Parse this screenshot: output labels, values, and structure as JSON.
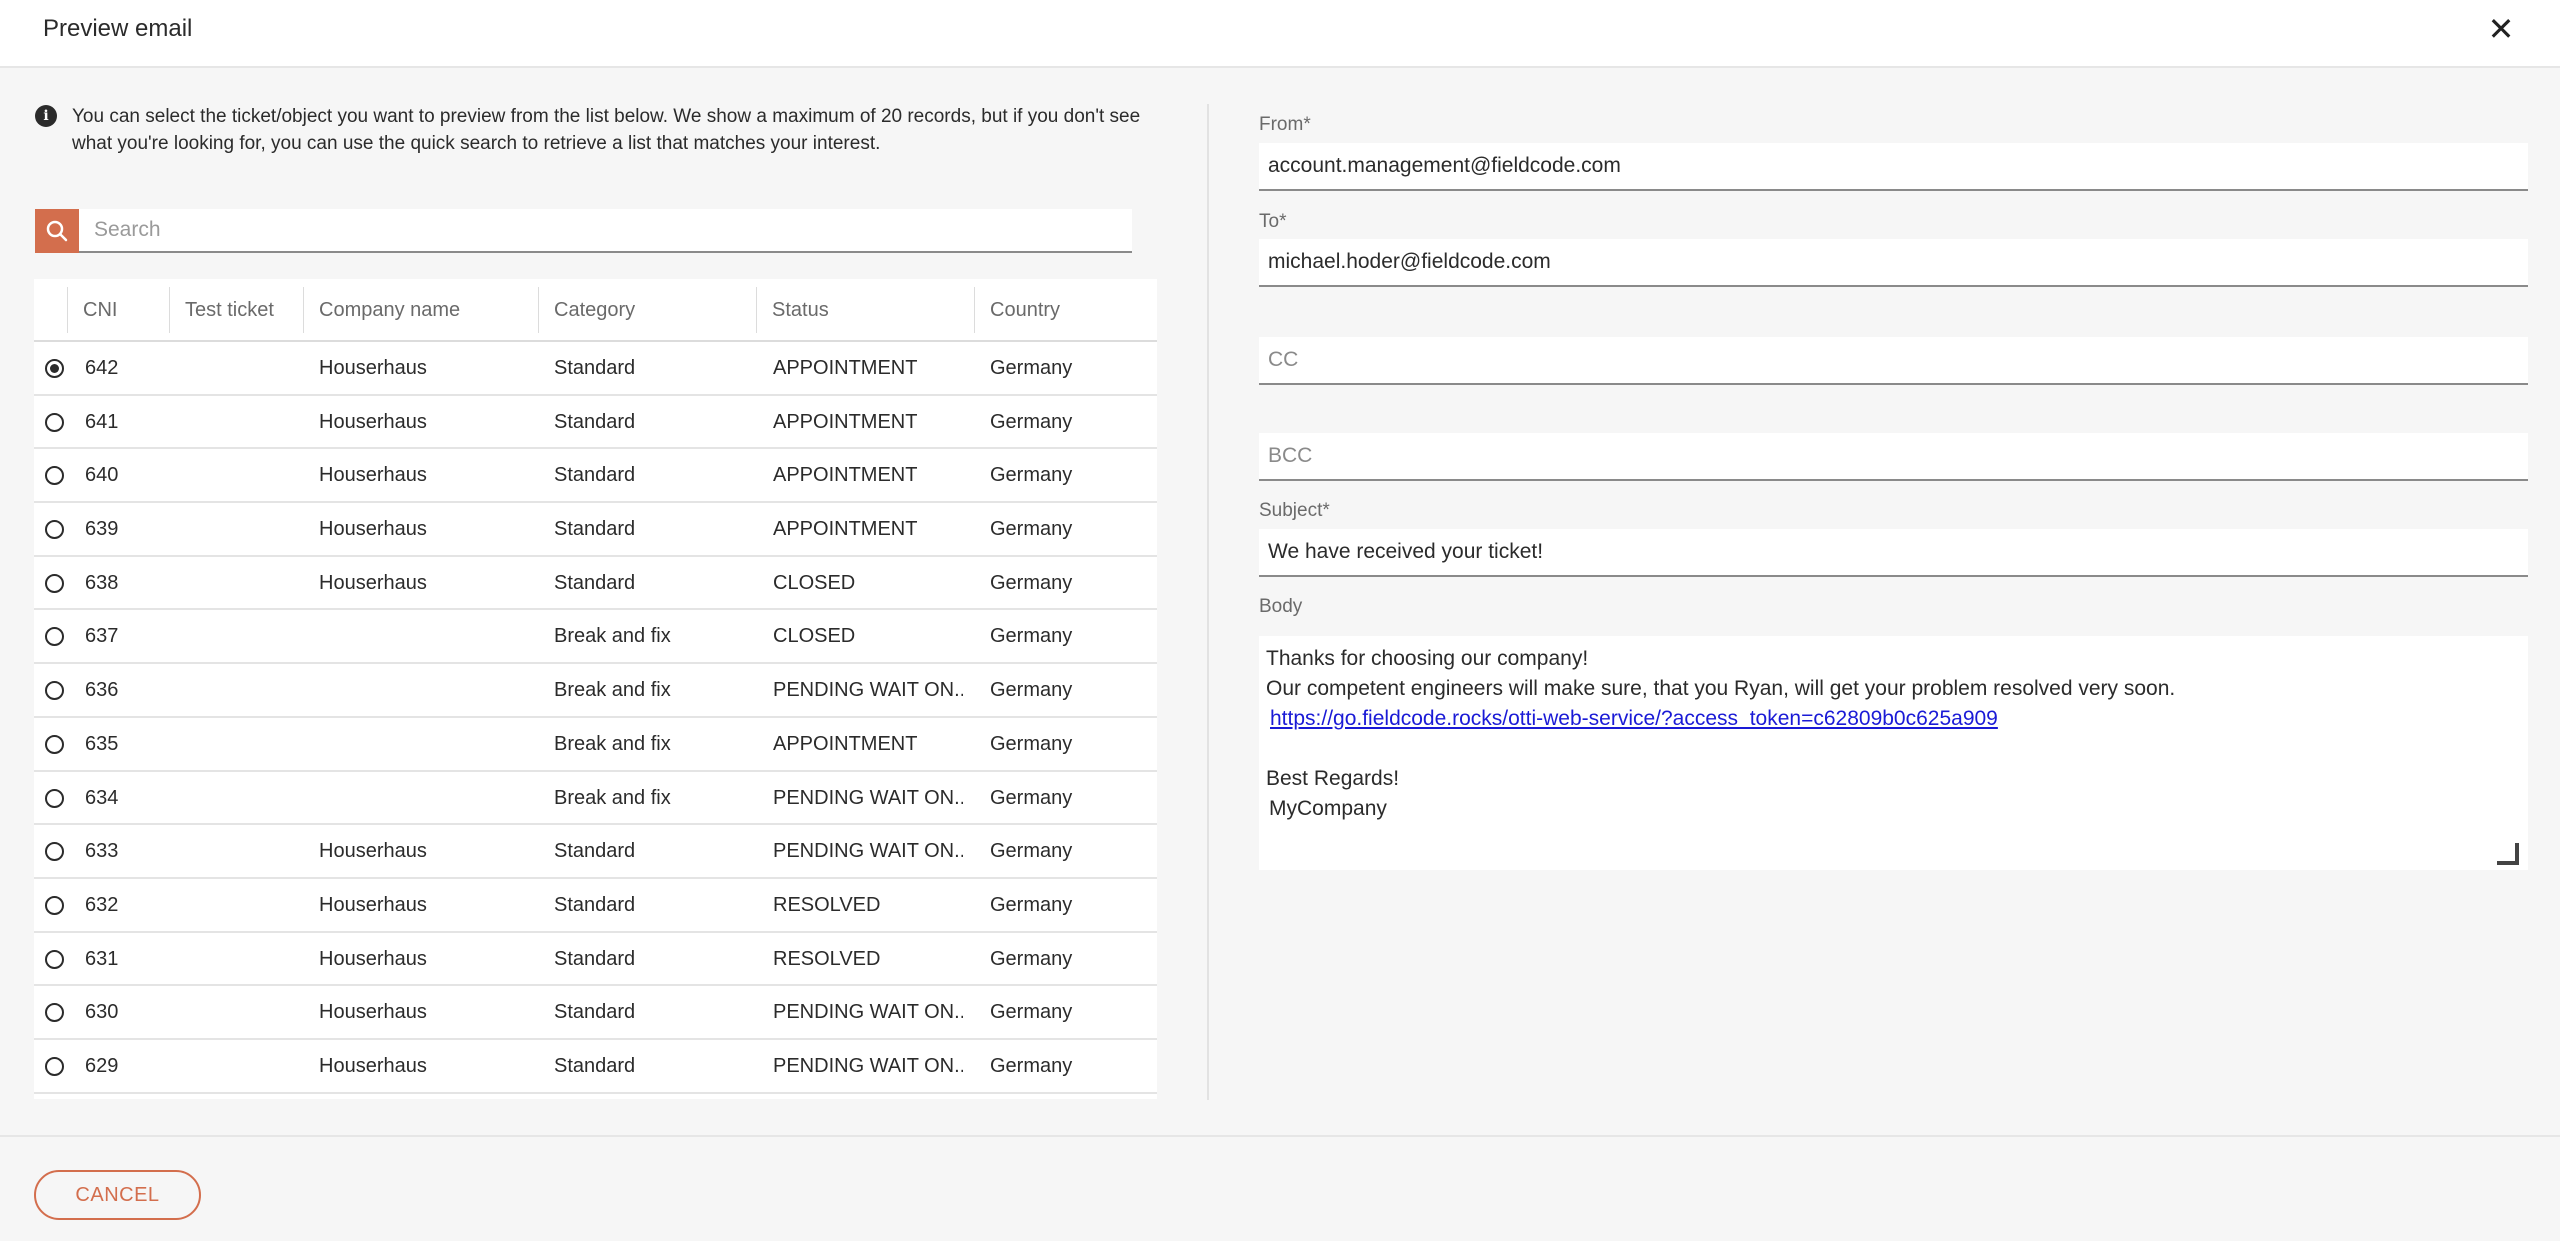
{
  "header": {
    "title": "Preview email",
    "close_icon": "close-icon"
  },
  "info": {
    "icon": "info-icon",
    "text": "You can select the ticket/object you want to preview from the list below. We show a maximum of 20 records, but if you don't see what you're looking for, you can use the quick search to retrieve a list that matches your interest."
  },
  "search": {
    "placeholder": "Search",
    "icon": "search-icon",
    "accent": "#d36e4d"
  },
  "table": {
    "columns": [
      "CNI",
      "Test ticket",
      "Company name",
      "Category",
      "Status",
      "Country"
    ],
    "rows": [
      {
        "selected": true,
        "cni": "642",
        "test": "",
        "company": "Houserhaus",
        "category": "Standard",
        "status": "APPOINTMENT",
        "country": "Germany"
      },
      {
        "selected": false,
        "cni": "641",
        "test": "",
        "company": "Houserhaus",
        "category": "Standard",
        "status": "APPOINTMENT",
        "country": "Germany"
      },
      {
        "selected": false,
        "cni": "640",
        "test": "",
        "company": "Houserhaus",
        "category": "Standard",
        "status": "APPOINTMENT",
        "country": "Germany"
      },
      {
        "selected": false,
        "cni": "639",
        "test": "",
        "company": "Houserhaus",
        "category": "Standard",
        "status": "APPOINTMENT",
        "country": "Germany"
      },
      {
        "selected": false,
        "cni": "638",
        "test": "",
        "company": "Houserhaus",
        "category": "Standard",
        "status": "CLOSED",
        "country": "Germany"
      },
      {
        "selected": false,
        "cni": "637",
        "test": "",
        "company": "",
        "category": "Break and fix",
        "status": "CLOSED",
        "country": "Germany"
      },
      {
        "selected": false,
        "cni": "636",
        "test": "",
        "company": "",
        "category": "Break and fix",
        "status": "PENDING WAIT ON...",
        "country": "Germany"
      },
      {
        "selected": false,
        "cni": "635",
        "test": "",
        "company": "",
        "category": "Break and fix",
        "status": "APPOINTMENT",
        "country": "Germany"
      },
      {
        "selected": false,
        "cni": "634",
        "test": "",
        "company": "",
        "category": "Break and fix",
        "status": "PENDING WAIT ON...",
        "country": "Germany"
      },
      {
        "selected": false,
        "cni": "633",
        "test": "",
        "company": "Houserhaus",
        "category": "Standard",
        "status": "PENDING WAIT ON...",
        "country": "Germany"
      },
      {
        "selected": false,
        "cni": "632",
        "test": "",
        "company": "Houserhaus",
        "category": "Standard",
        "status": "RESOLVED",
        "country": "Germany"
      },
      {
        "selected": false,
        "cni": "631",
        "test": "",
        "company": "Houserhaus",
        "category": "Standard",
        "status": "RESOLVED",
        "country": "Germany"
      },
      {
        "selected": false,
        "cni": "630",
        "test": "",
        "company": "Houserhaus",
        "category": "Standard",
        "status": "PENDING WAIT ON...",
        "country": "Germany"
      },
      {
        "selected": false,
        "cni": "629",
        "test": "",
        "company": "Houserhaus",
        "category": "Standard",
        "status": "PENDING WAIT ON...",
        "country": "Germany"
      }
    ]
  },
  "email": {
    "from_label": "From*",
    "from_value": "account.management@fieldcode.com",
    "to_label": "To*",
    "to_value": "michael.hoder@fieldcode.com",
    "cc_placeholder": "CC",
    "bcc_placeholder": "BCC",
    "subject_label": "Subject*",
    "subject_value": "We have received your ticket!",
    "body_label": "Body",
    "body": {
      "line1": "Thanks for choosing our company!",
      "line2": "Our competent engineers will make sure, that you Ryan, will get your problem resolved very soon.",
      "link": "https://go.fieldcode.rocks/otti-web-service/?access_token=c62809b0c625a909",
      "line4": "Best Regards!",
      "line5": "MyCompany"
    }
  },
  "footer": {
    "cancel_label": "CANCEL"
  }
}
